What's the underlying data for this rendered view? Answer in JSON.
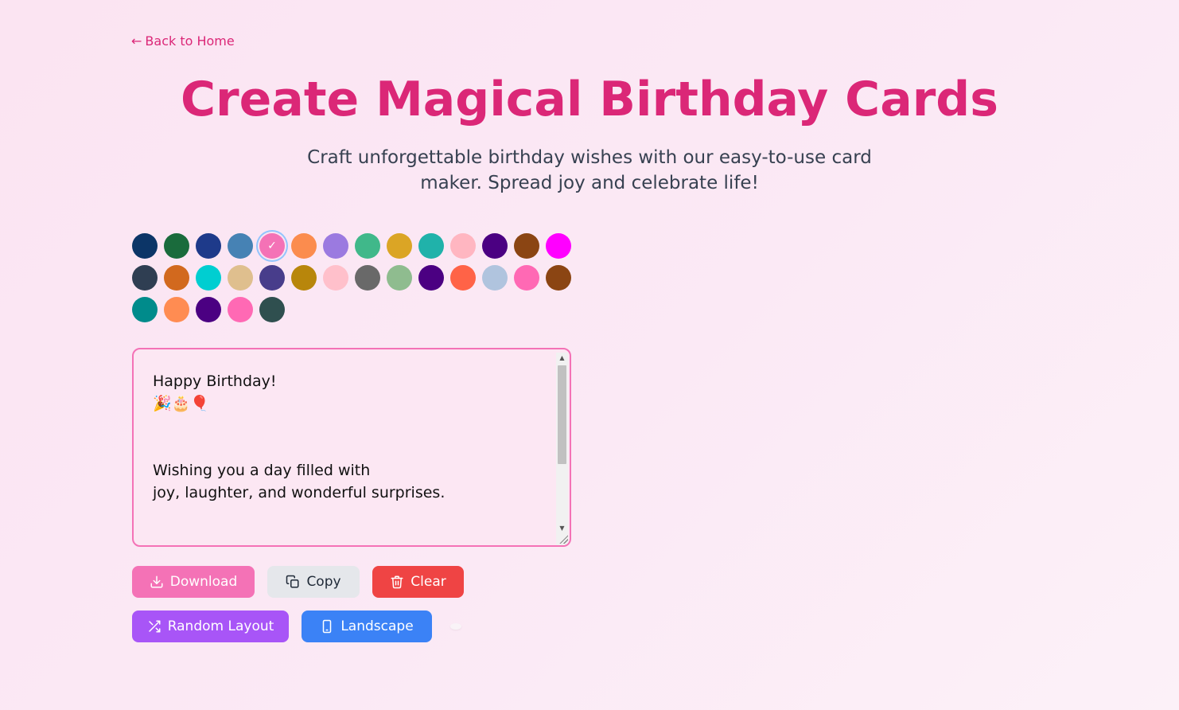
{
  "nav": {
    "back_arrow": "←",
    "back_label": "Back to Home"
  },
  "header": {
    "title": "Create Magical Birthday Cards",
    "subtitle": "Craft unforgettable birthday wishes with our easy-to-use card maker. Spread joy and celebrate life!"
  },
  "palette": {
    "selected_index": 4,
    "colors": [
      "#0c3567",
      "#1a6b3c",
      "#1e3a8a",
      "#4682b4",
      "#f472b6",
      "#fb8c4e",
      "#9b7ae0",
      "#40b88a",
      "#dba525",
      "#20b2aa",
      "#ffb6c1",
      "#4b0082",
      "#8b4513",
      "#ff00ff",
      "#2f3e52",
      "#d2691e",
      "#00ced1",
      "#dfbf8e",
      "#483d8b",
      "#b8860b",
      "#ffc0cb",
      "#696969",
      "#8fbc8f",
      "#4b0082",
      "#ff6347",
      "#b0c4de",
      "#ff69b4",
      "#8b4513",
      "#008b8b",
      "#ff8c52",
      "#4b0082",
      "#ff69b4",
      "#2f4f4f"
    ]
  },
  "editor": {
    "text": "Happy Birthday!\n🎉🎂🎈\n\n\nWishing you a day filled with\njoy, laughter, and wonderful surprises."
  },
  "actions": {
    "download": "Download",
    "copy": "Copy",
    "clear": "Clear",
    "random_layout": "Random Layout",
    "landscape": "Landscape"
  }
}
